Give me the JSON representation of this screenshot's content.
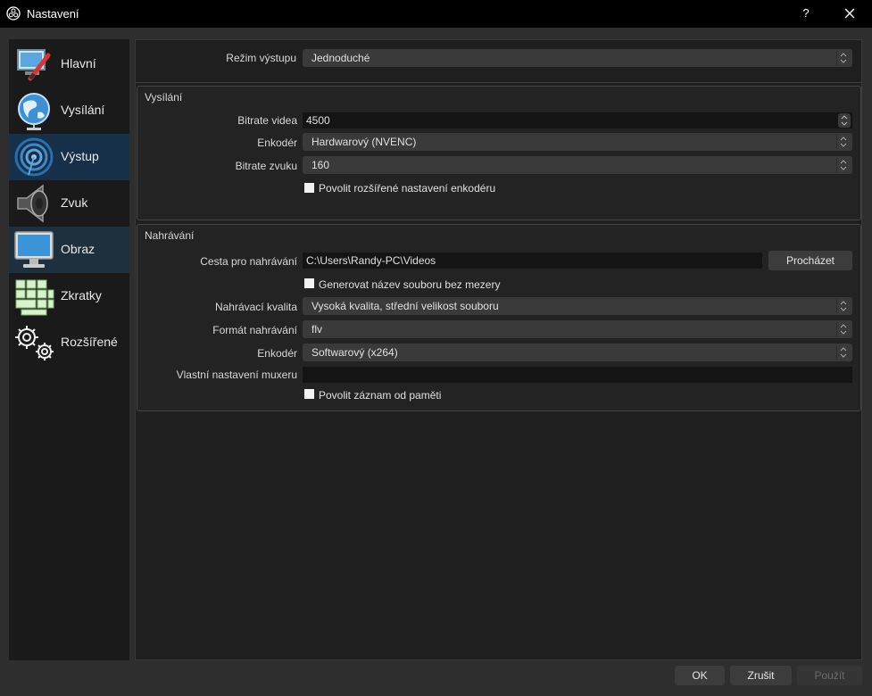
{
  "window": {
    "title": "Nastavení",
    "help": "?",
    "close_icon": "close-icon"
  },
  "sidebar": {
    "items": [
      {
        "label": "Hlavní",
        "icon": "general-icon"
      },
      {
        "label": "Vysílání",
        "icon": "globe-icon"
      },
      {
        "label": "Výstup",
        "icon": "broadcast-icon",
        "selected": true
      },
      {
        "label": "Zvuk",
        "icon": "speaker-icon"
      },
      {
        "label": "Obraz",
        "icon": "monitor-icon"
      },
      {
        "label": "Zkratky",
        "icon": "keyboard-icon"
      },
      {
        "label": "Rozšířené",
        "icon": "gears-icon"
      }
    ]
  },
  "output_mode": {
    "label": "Režim výstupu",
    "value": "Jednoduché"
  },
  "streaming": {
    "title": "Vysílání",
    "video_bitrate": {
      "label": "Bitrate videa",
      "value": "4500"
    },
    "encoder": {
      "label": "Enkodér",
      "value": "Hardwarový (NVENC)"
    },
    "audio_bitrate": {
      "label": "Bitrate zvuku",
      "value": "160"
    },
    "advanced": {
      "label": "Povolit rozšířené nastavení enkodéru",
      "checked": false
    }
  },
  "recording": {
    "title": "Nahrávání",
    "path": {
      "label": "Cesta pro nahrávání",
      "value": "C:\\Users\\Randy-PC\\Videos",
      "browse": "Procházet"
    },
    "no_space": {
      "label": "Generovat název souboru bez mezery",
      "checked": false
    },
    "quality": {
      "label": "Nahrávací kvalita",
      "value": "Vysoká kvalita, střední velikost souboru"
    },
    "format": {
      "label": "Formát nahrávání",
      "value": "flv"
    },
    "encoder": {
      "label": "Enkodér",
      "value": "Softwarový (x264)"
    },
    "muxer": {
      "label": "Vlastní nastavení muxeru",
      "value": ""
    },
    "replay": {
      "label": "Povolit záznam od paměti",
      "checked": false
    }
  },
  "buttons": {
    "ok": "OK",
    "cancel": "Zrušit",
    "apply": "Použít"
  }
}
